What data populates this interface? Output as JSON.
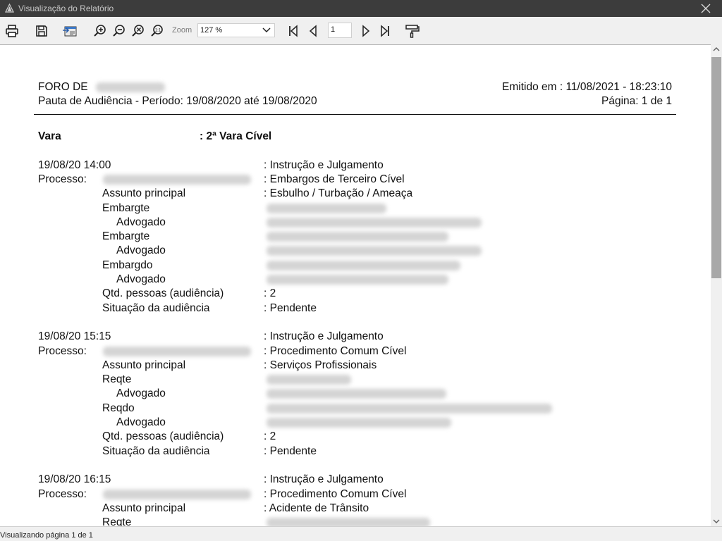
{
  "window": {
    "title": "Visualização do Relatório"
  },
  "toolbar": {
    "zoom_label": "Zoom",
    "zoom_value": "127 %",
    "page_number": "1",
    "icons": [
      "print-icon",
      "save-icon",
      "export-icon",
      "zoom-in-icon",
      "zoom-out-icon",
      "zoom-fit-icon",
      "zoom-actual-icon",
      "first-page-icon",
      "prev-page-icon",
      "next-page-icon",
      "last-page-icon",
      "paint-roller-icon"
    ]
  },
  "report": {
    "header": {
      "foro": "FORO DE",
      "pauta": "Pauta de Audiência  -  Período: 19/08/2020 até 19/08/2020",
      "emitido": "Emitido em : 11/08/2021 - 18:23:10",
      "pagina": "Página: 1 de 1"
    },
    "vara_label": "Vara",
    "vara_value": ": 2ª Vara Cível",
    "entries": [
      {
        "datetime": "19/08/20 14:00",
        "tipo": ": Instrução e Julgamento",
        "processo_label": "Processo:",
        "classe": ": Embargos de Terceiro Cível",
        "assunto_label": "Assunto principal",
        "assunto": ": Esbulho / Turbação / Ameaça",
        "partes": [
          "Embargte",
          "Advogado",
          "Embargte",
          "Advogado",
          "Embargdo",
          "Advogado"
        ],
        "qtd_label": "Qtd. pessoas (audiência)",
        "qtd": ": 2",
        "situacao_label": "Situação da audiência",
        "situacao": ": Pendente"
      },
      {
        "datetime": "19/08/20 15:15",
        "tipo": ": Instrução e Julgamento",
        "processo_label": "Processo:",
        "classe": ": Procedimento Comum Cível",
        "assunto_label": "Assunto principal",
        "assunto": ": Serviços Profissionais",
        "partes": [
          "Reqte",
          "Advogado",
          "Reqdo",
          "Advogado"
        ],
        "qtd_label": "Qtd. pessoas (audiência)",
        "qtd": ": 2",
        "situacao_label": "Situação da audiência",
        "situacao": ": Pendente"
      },
      {
        "datetime": "19/08/20 16:15",
        "tipo": ": Instrução e Julgamento",
        "processo_label": "Processo:",
        "classe": ": Procedimento Comum Cível",
        "assunto_label": "Assunto principal",
        "assunto": ": Acidente de Trânsito",
        "partes": [
          "Reqte"
        ]
      }
    ]
  },
  "status": {
    "text": "Visualizando página 1 de 1"
  }
}
